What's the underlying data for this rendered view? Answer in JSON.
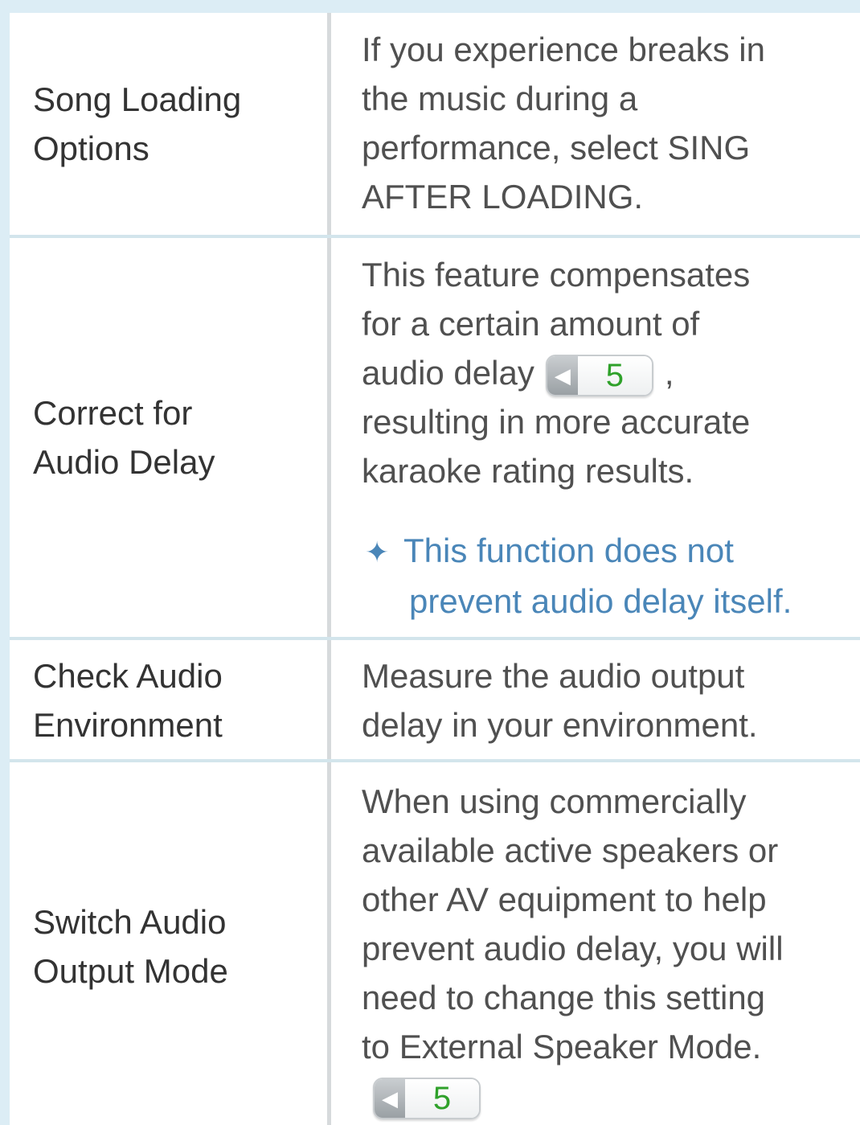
{
  "rows": [
    {
      "label": [
        "Song Loading",
        "Options"
      ],
      "desc": [
        "If you experience breaks in",
        "the music during a",
        "performance, select SING",
        "AFTER LOADING."
      ]
    },
    {
      "label": [
        "Correct for",
        "Audio Delay"
      ],
      "desc_before": [
        "This feature compensates",
        "for a certain amount of",
        "audio delay"
      ],
      "ref_page": "5",
      "desc_after_ref": ",",
      "desc_rest": [
        "resulting in more accurate",
        "karaoke rating results."
      ],
      "note_symbol": "✦",
      "note": [
        "This function does not",
        "prevent audio delay itself."
      ]
    },
    {
      "label": [
        "Check Audio",
        "Environment"
      ],
      "desc": [
        "Measure the audio output",
        "delay in your environment."
      ]
    },
    {
      "label": [
        "Switch Audio",
        "Output Mode"
      ],
      "desc": [
        "When using commercially",
        "available active speakers or",
        "other AV equipment to help",
        "prevent audio delay, you will",
        "need to change this setting",
        "to External Speaker Mode."
      ],
      "ref_page": "5"
    }
  ],
  "colors": {
    "page_background": "#dcedf5",
    "note_text": "#4a86b8",
    "page_number": "#2fa12a"
  },
  "icons": {
    "page_ref_arrow": "back-arrow-icon"
  }
}
